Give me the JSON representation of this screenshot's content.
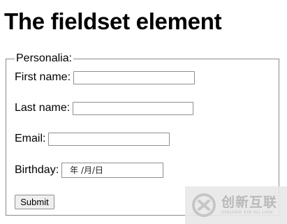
{
  "page": {
    "title": "The fieldset element"
  },
  "form": {
    "legend": "Personalia:",
    "fields": [
      {
        "label": "First name:",
        "value": ""
      },
      {
        "label": "Last name:",
        "value": ""
      },
      {
        "label": "Email:",
        "value": ""
      },
      {
        "label": "Birthday:",
        "value": "年 /月/日"
      }
    ],
    "submit_label": "Submit"
  },
  "watermark": {
    "brand": "创新互联",
    "sub": "CHUANG XIN HU LIAN"
  }
}
